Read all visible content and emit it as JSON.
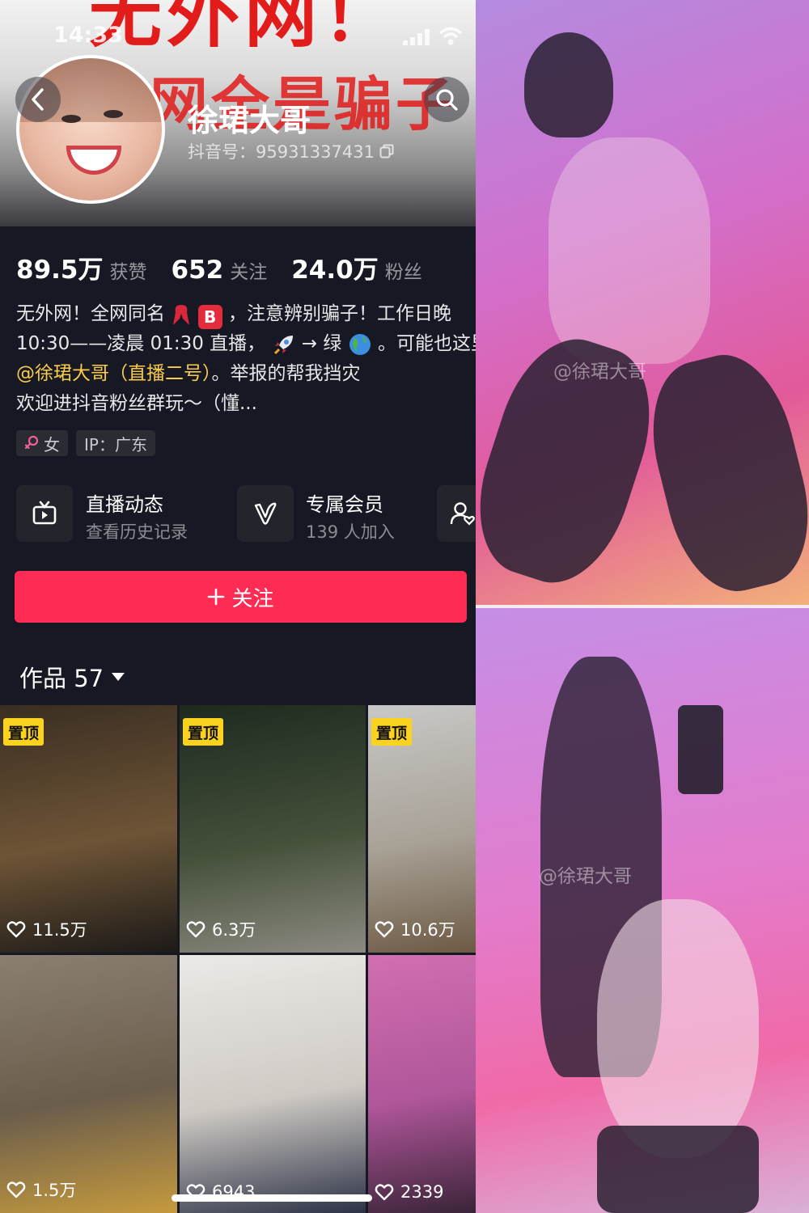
{
  "status": {
    "time": "14:33"
  },
  "cover": {
    "headline_1": "无外网！",
    "headline_2": "网全是骗子"
  },
  "profile": {
    "name": "徐珺大哥",
    "douyin_id_label": "抖音号：95931337431"
  },
  "stats": [
    {
      "value": "89.5万",
      "label": "获赞"
    },
    {
      "value": "652",
      "label": "关注"
    },
    {
      "value": "24.0万",
      "label": "粉丝"
    }
  ],
  "bio": {
    "line1_a": "无外网！全网同名",
    "line1_b": "，注意辨别骗子！工作日晚",
    "line2_a": "10:30——凌晨 01:30 直播，",
    "line2_b": "→ 绿",
    "line2_c": "。可能也这里",
    "line3_mention": "@徐珺大哥（直播二号）",
    "line3_rest": "。举报的帮我挡灾",
    "line4": "欢迎进抖音粉丝群玩～（懂..."
  },
  "tags": {
    "gender": "女",
    "ip": "IP：广东"
  },
  "features": {
    "live": {
      "title": "直播动态",
      "subtitle": "查看历史记录"
    },
    "member": {
      "title": "专属会员",
      "subtitle": "139 人加入"
    }
  },
  "follow_button": {
    "label": "关注"
  },
  "works": {
    "label": "作品 57"
  },
  "videos": [
    {
      "pinned": true,
      "pin_label": "置顶",
      "likes": "11.5万",
      "colors": [
        "#3a2e22",
        "#6e5436",
        "#1c1a18"
      ]
    },
    {
      "pinned": true,
      "pin_label": "置顶",
      "likes": "6.3万",
      "colors": [
        "#1e2a1e",
        "#44503a",
        "#8c8a80"
      ]
    },
    {
      "pinned": true,
      "pin_label": "置顶",
      "likes": "10.6万",
      "colors": [
        "#c8c8c6",
        "#a8a196",
        "#6d5a44"
      ]
    },
    {
      "pinned": false,
      "pin_label": "",
      "likes": "1.5万",
      "colors": [
        "#8a7f70",
        "#6b5d4c",
        "#c59a3e"
      ]
    },
    {
      "pinned": false,
      "pin_label": "",
      "likes": "6943",
      "colors": [
        "#ebe9e6",
        "#cfcac4",
        "#2c3246"
      ]
    },
    {
      "pinned": false,
      "pin_label": "",
      "likes": "2339",
      "colors": [
        "#d16fb0",
        "#b0569a",
        "#3a2438"
      ]
    }
  ],
  "photos": {
    "watermark_1": "@徐珺大哥",
    "watermark_2": "@徐珺大哥"
  },
  "icons": {
    "back": "chevron-left-icon",
    "search": "search-icon",
    "copy": "copy-icon",
    "female": "female-icon",
    "live": "tv-icon",
    "member": "v-badge-icon",
    "group": "group-icon",
    "heart": "heart-outline-icon",
    "plus": "plus-icon",
    "caret": "caret-down-icon"
  },
  "colors": {
    "accent": "#fe2c55",
    "pin": "#fbd21d",
    "mention": "#facc4a",
    "background": "#161823"
  }
}
